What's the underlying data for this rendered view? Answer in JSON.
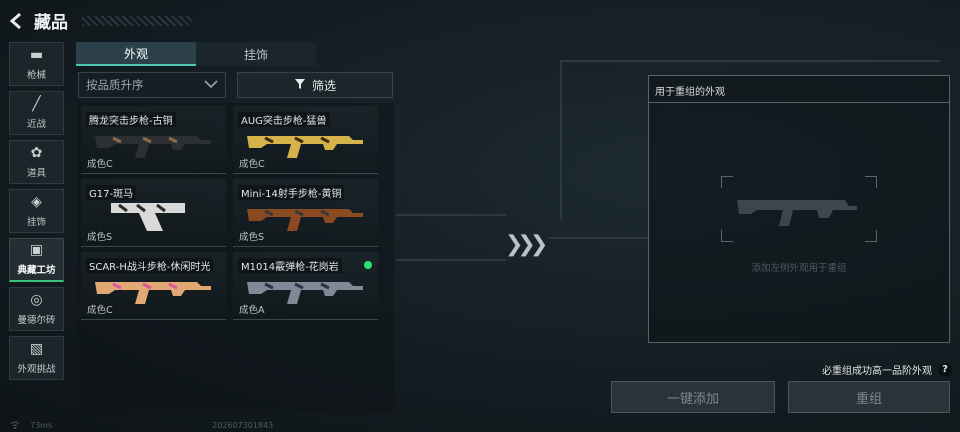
{
  "header": {
    "title": "藏品",
    "back_icon": "back-arrow-icon"
  },
  "nav": [
    {
      "label": "枪械",
      "icon": "pistol-icon",
      "glyph": "▬"
    },
    {
      "label": "近战",
      "icon": "knife-icon",
      "glyph": "╱"
    },
    {
      "label": "道具",
      "icon": "grenade-icon",
      "glyph": "✿"
    },
    {
      "label": "挂饰",
      "icon": "charm-icon",
      "glyph": "◈"
    },
    {
      "label": "典藏工坊",
      "icon": "workshop-icon",
      "glyph": "▣",
      "active": true
    },
    {
      "label": "曼德尔砖",
      "icon": "brick-icon",
      "glyph": "◎"
    },
    {
      "label": "外观挑战",
      "icon": "challenge-icon",
      "glyph": "▧"
    }
  ],
  "tabs": [
    {
      "label": "外观",
      "active": true
    },
    {
      "label": "挂饰",
      "active": false
    }
  ],
  "sort": {
    "label": "按品质升序"
  },
  "filter": {
    "label": "筛选"
  },
  "items": [
    {
      "name": "腾龙突击步枪-古铜",
      "quality": "成色C",
      "color": "#2c2f33",
      "accent": "#8a6a4a"
    },
    {
      "name": "AUG突击步枪-猛兽",
      "quality": "成色C",
      "color": "#d6b24a",
      "accent": "#3a2c12"
    },
    {
      "name": "G17-斑马",
      "quality": "成色S",
      "color": "#d9d9d9",
      "accent": "#2a2a2a"
    },
    {
      "name": "Mini-14射手步枪-黄铜",
      "quality": "成色S",
      "color": "#8b4a22",
      "accent": "#3a3a3a"
    },
    {
      "name": "SCAR-H战斗步枪-休闲时光",
      "quality": "成色C",
      "color": "#e2a873",
      "accent": "#d85aa0"
    },
    {
      "name": "M1014霰弹枪-花岗岩",
      "quality": "成色A",
      "color": "#7f8a96",
      "accent": "#2a3440",
      "new": true
    }
  ],
  "reassemble": {
    "title": "用于重组的外观",
    "hint": "添加左侧外观用于重组"
  },
  "must_text": "必重组成功高一品阶外观",
  "help_icon": "?",
  "buttons": {
    "add_all": "一键添加",
    "reassemble": "重组"
  },
  "footer": {
    "ping": "73ms",
    "build": "202607301843"
  },
  "transfer_arrows": "❯❯❯"
}
